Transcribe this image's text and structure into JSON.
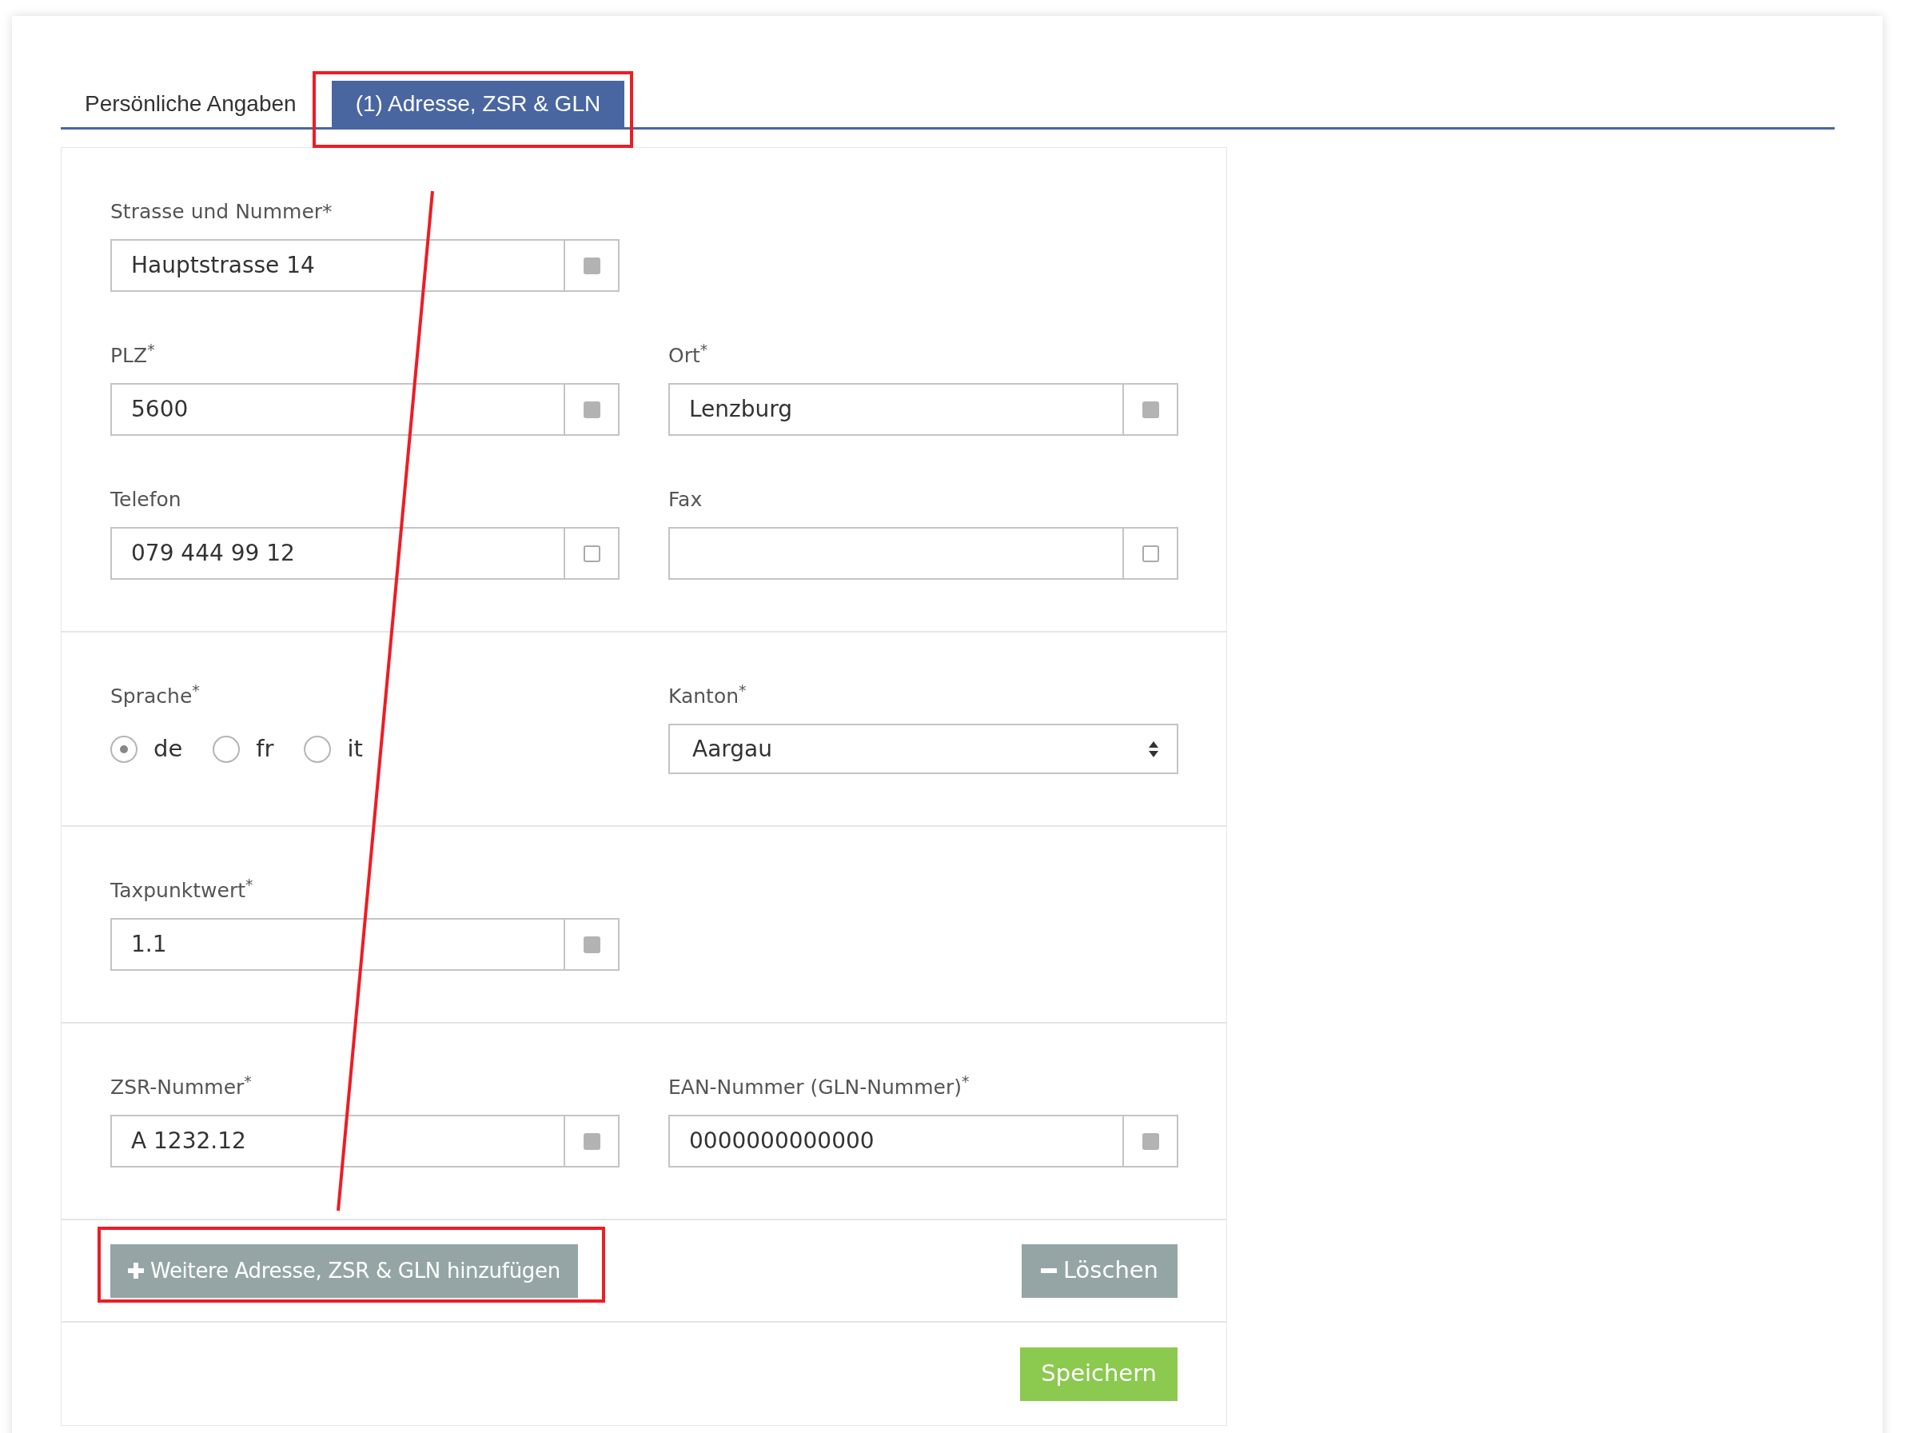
{
  "tabs": [
    {
      "label": "Persönliche Angaben",
      "selected": false
    },
    {
      "label": "(1) Adresse, ZSR & GLN",
      "selected": true
    }
  ],
  "sections": [
    {
      "rows": [
        [
          {
            "kind": "text",
            "label": "Strasse und Nummer*",
            "value": "Hauptstrasse 14",
            "checked": true
          }
        ],
        [
          {
            "kind": "text",
            "label": "PLZ$^{*}$",
            "value": "5600",
            "checked": true
          },
          {
            "kind": "text",
            "label": "Ort$^{*}$",
            "value": "Lenzburg",
            "checked": true
          }
        ],
        [
          {
            "kind": "text",
            "label": "Telefon",
            "value": "079 444 99 12",
            "checked": false
          },
          {
            "kind": "text",
            "label": "Fax",
            "checked": false
          }
        ]
      ]
    },
    {
      "rows": [
        [
          {
            "kind": "radio",
            "label": "Sprache$^{*}$",
            "options": [
              {
                "label": "de",
                "selected": true
              },
              {
                "label": "fr",
                "selected": false
              },
              {
                "label": "it",
                "selected": false
              }
            ]
          },
          {
            "kind": "select",
            "label": "Kanton$^{*}$",
            "value": "Aargau"
          }
        ]
      ]
    },
    {
      "rows": [
        [
          {
            "kind": "text",
            "label": "Taxpunktwert$^{*}$",
            "value": "1.1",
            "checked": true
          }
        ]
      ]
    },
    {
      "rows": [
        [
          {
            "kind": "text",
            "label": "ZSR-Nummer$^{*}$",
            "value": "A 1232.12",
            "checked": true
          },
          {
            "kind": "text",
            "label": "EAN-Nummer (GLN-Nummer)$^{*}$",
            "value": "0000000000000",
            "checked": true
          }
        ]
      ]
    }
  ],
  "add_button": "Weitere Adresse, ZSR & GLN hinzufügen",
  "delete_button": "Löschen",
  "save_button": "Speichern"
}
